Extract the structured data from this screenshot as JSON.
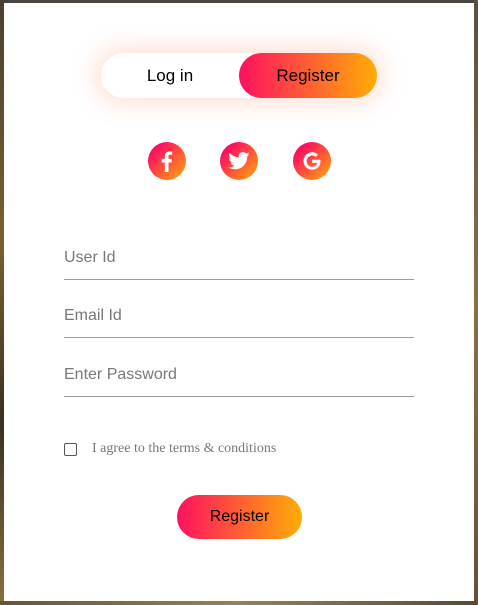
{
  "toggle": {
    "login_label": "Log in",
    "register_label": "Register",
    "active": "Register"
  },
  "social": [
    {
      "name": "facebook-icon"
    },
    {
      "name": "twitter-icon"
    },
    {
      "name": "google-icon"
    }
  ],
  "form": {
    "user_id": {
      "placeholder": "User Id",
      "value": ""
    },
    "email_id": {
      "placeholder": "Email Id",
      "value": ""
    },
    "password": {
      "placeholder": "Enter Password",
      "value": ""
    },
    "terms_label": "I agree to the terms & conditions",
    "terms_checked": false,
    "submit_label": "Register"
  },
  "colors": {
    "gradient_start": "#ff105f",
    "gradient_end": "#ffad06"
  }
}
